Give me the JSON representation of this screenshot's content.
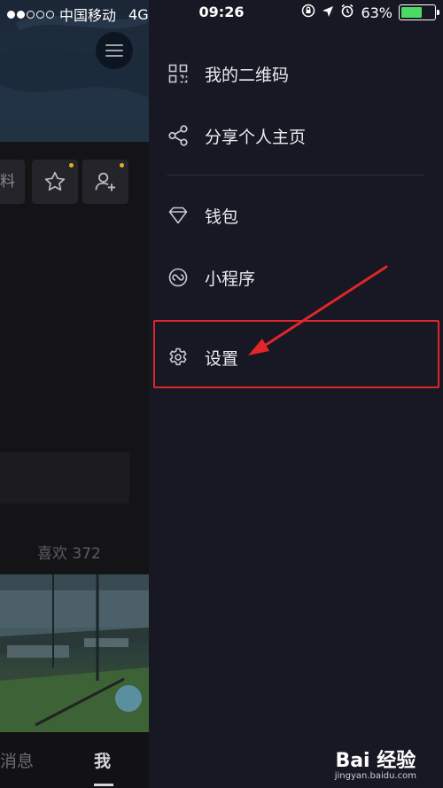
{
  "status_bar": {
    "carrier": "中国移动",
    "network": "4G",
    "time": "09:26",
    "battery_percent": "63%",
    "battery_level": 0.63
  },
  "profile": {
    "partial_button_text": "料",
    "likes_label": "喜欢 372",
    "tabs": [
      {
        "label": "消息"
      },
      {
        "label": "我"
      }
    ]
  },
  "drawer": {
    "items": [
      {
        "label": "我的二维码",
        "icon": "qr-code-icon"
      },
      {
        "label": "分享个人主页",
        "icon": "share-icon"
      },
      {
        "label": "钱包",
        "icon": "wallet-icon"
      },
      {
        "label": "小程序",
        "icon": "mini-program-icon"
      },
      {
        "label": "设置",
        "icon": "settings-gear-icon"
      }
    ]
  },
  "watermark": {
    "logo": "Bai 经验",
    "site": "jingyan.baidu.com"
  },
  "colors": {
    "drawer_bg": "#171823",
    "highlight": "#e0262a",
    "battery_fill": "#4cd964",
    "badge": "#e0b020"
  }
}
